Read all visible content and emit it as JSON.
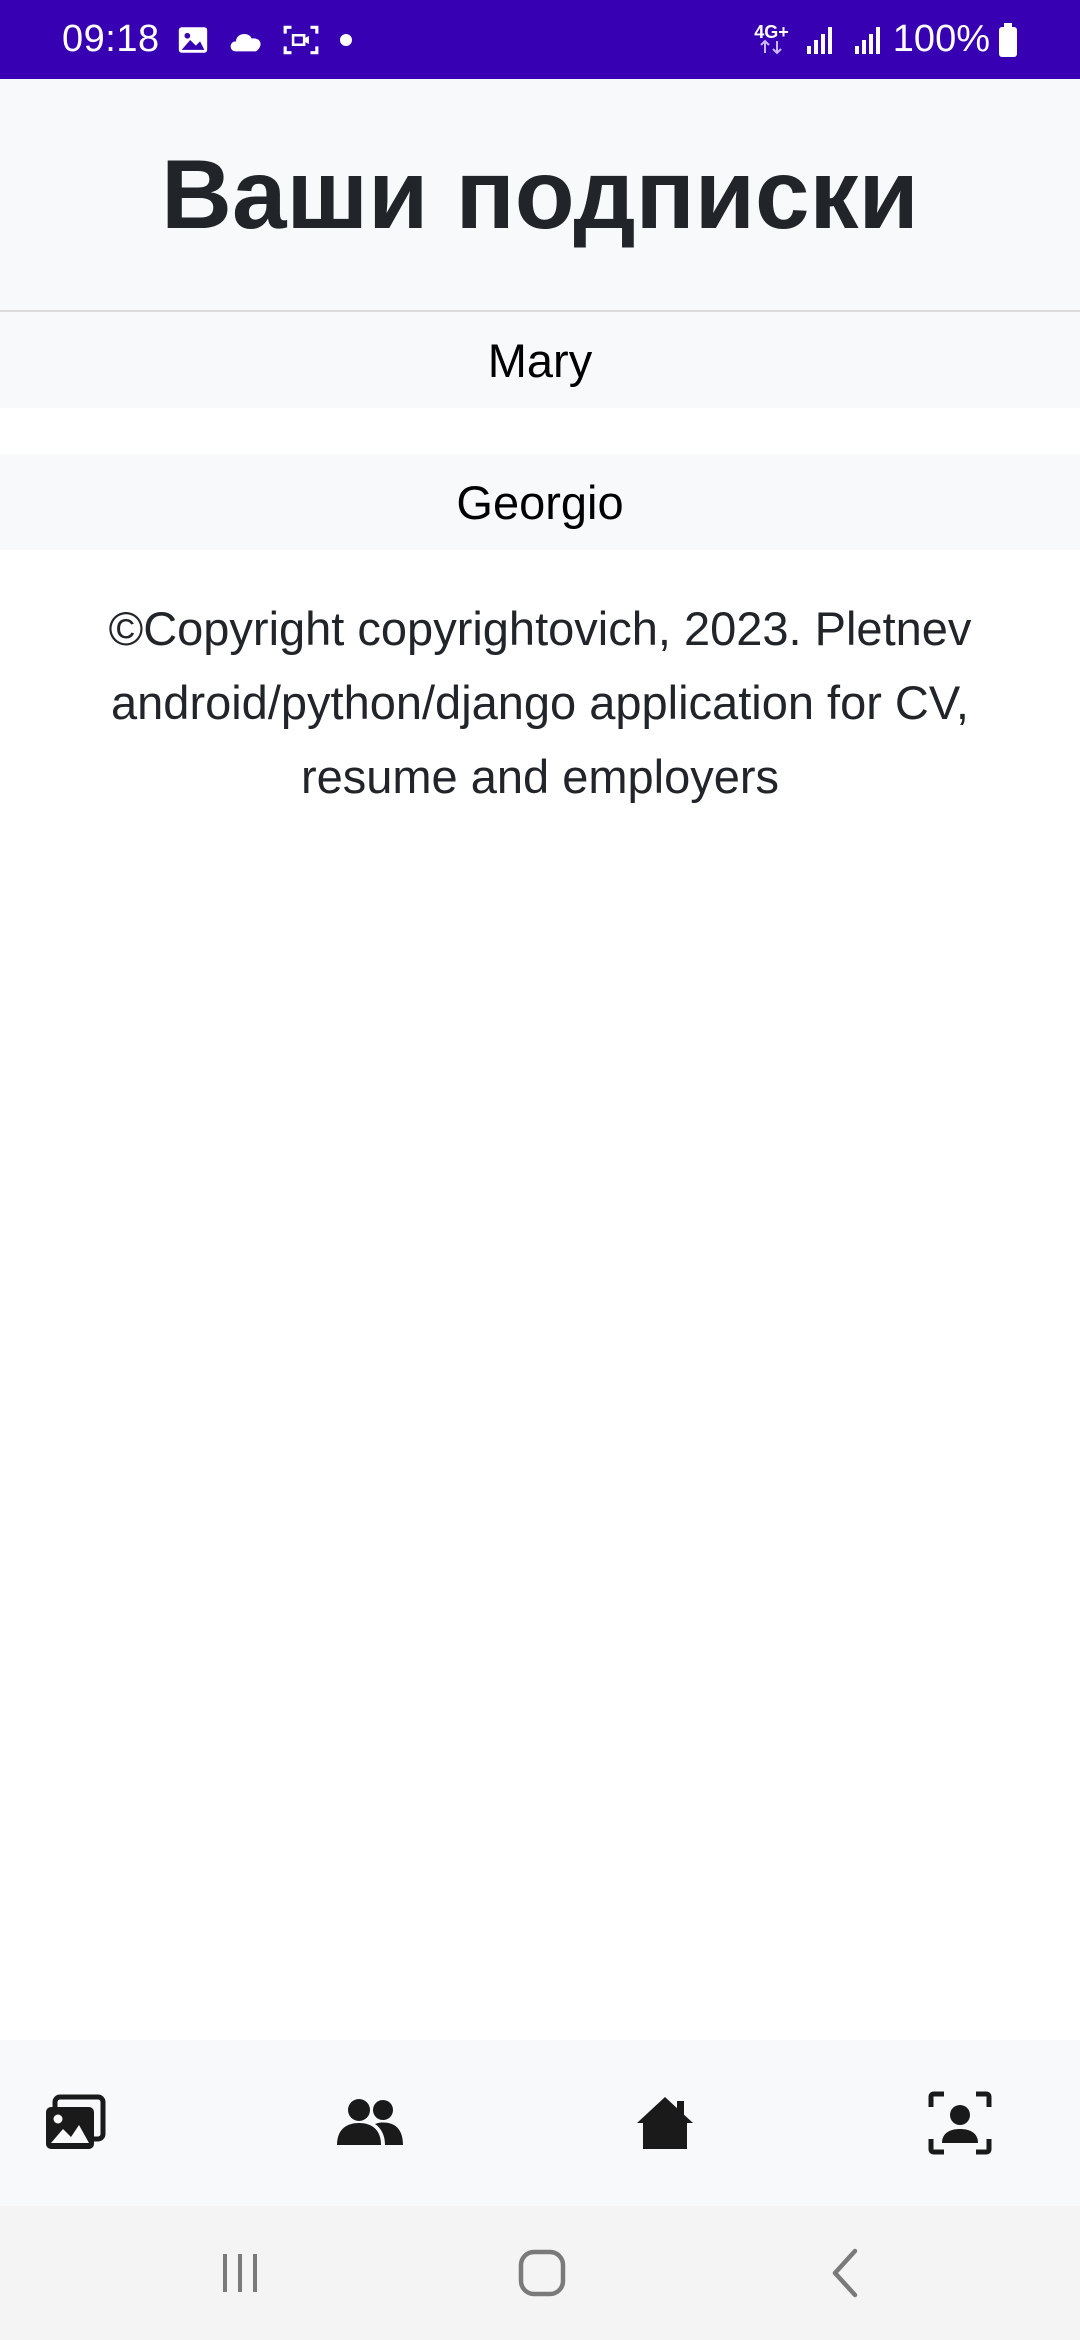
{
  "status_bar": {
    "time": "09:18",
    "network": "4G+",
    "battery": "100%",
    "icons": [
      "image-icon",
      "cloud-icon",
      "screen-record-icon",
      "dot-icon",
      "network-4g-icon",
      "signal-icon",
      "signal-icon",
      "battery-icon"
    ]
  },
  "header": {
    "title": "Ваши подписки"
  },
  "subscriptions": [
    {
      "name": "Mary"
    },
    {
      "name": "Georgio"
    }
  ],
  "footer": {
    "text": "©Copyright copyrightovich, 2023. Pletnev android/python/django application for CV, resume and employers"
  },
  "bottom_nav": {
    "items": [
      "gallery-icon",
      "people-icon",
      "home-icon",
      "profile-icon"
    ]
  },
  "system_nav": {
    "items": [
      "recents-icon",
      "home-icon",
      "back-icon"
    ]
  },
  "colors": {
    "status_bar": "#3700b3",
    "header_bg": "#f8f9fa",
    "title_text": "#212529",
    "icon": "#1a1a1a",
    "system_nav_icon": "#7a7a7a"
  }
}
